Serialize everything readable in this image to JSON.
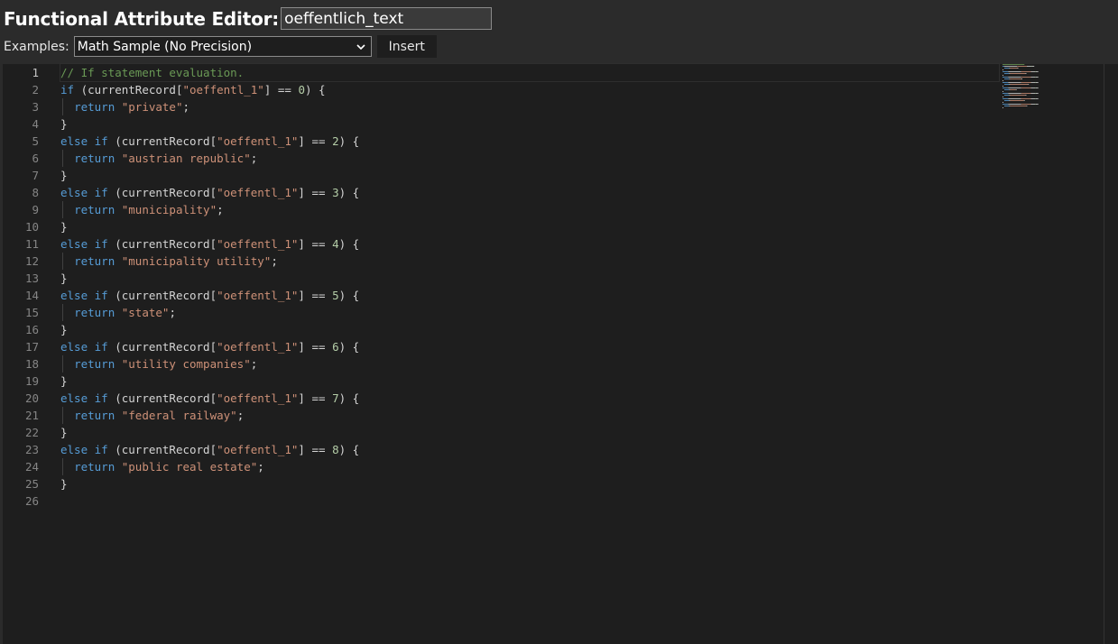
{
  "header": {
    "title_label": "Functional Attribute Editor:",
    "name_value": "oeffentlich_text",
    "examples_label": "Examples:",
    "examples_selected": "Math Sample (No Precision)",
    "insert_label": "Insert"
  },
  "editor": {
    "active_line": 1,
    "lines": [
      {
        "n": "1",
        "indent": false,
        "tokens": [
          {
            "t": "comment",
            "v": "// If statement evaluation."
          }
        ]
      },
      {
        "n": "2",
        "indent": false,
        "tokens": [
          {
            "t": "keyword",
            "v": "if"
          },
          {
            "t": "plain",
            "v": " (currentRecord["
          },
          {
            "t": "string",
            "v": "\"oeffentl_1\""
          },
          {
            "t": "plain",
            "v": "] == "
          },
          {
            "t": "number",
            "v": "0"
          },
          {
            "t": "plain",
            "v": ") {"
          }
        ]
      },
      {
        "n": "3",
        "indent": true,
        "tokens": [
          {
            "t": "keyword",
            "v": "return"
          },
          {
            "t": "plain",
            "v": " "
          },
          {
            "t": "string",
            "v": "\"private\""
          },
          {
            "t": "plain",
            "v": ";"
          }
        ]
      },
      {
        "n": "4",
        "indent": false,
        "tokens": [
          {
            "t": "plain",
            "v": "}"
          }
        ]
      },
      {
        "n": "5",
        "indent": false,
        "tokens": [
          {
            "t": "keyword",
            "v": "else if"
          },
          {
            "t": "plain",
            "v": " (currentRecord["
          },
          {
            "t": "string",
            "v": "\"oeffentl_1\""
          },
          {
            "t": "plain",
            "v": "] == "
          },
          {
            "t": "number",
            "v": "2"
          },
          {
            "t": "plain",
            "v": ") {"
          }
        ]
      },
      {
        "n": "6",
        "indent": true,
        "tokens": [
          {
            "t": "keyword",
            "v": "return"
          },
          {
            "t": "plain",
            "v": " "
          },
          {
            "t": "string",
            "v": "\"austrian republic\""
          },
          {
            "t": "plain",
            "v": ";"
          }
        ]
      },
      {
        "n": "7",
        "indent": false,
        "tokens": [
          {
            "t": "plain",
            "v": "}"
          }
        ]
      },
      {
        "n": "8",
        "indent": false,
        "tokens": [
          {
            "t": "keyword",
            "v": "else if"
          },
          {
            "t": "plain",
            "v": " (currentRecord["
          },
          {
            "t": "string",
            "v": "\"oeffentl_1\""
          },
          {
            "t": "plain",
            "v": "] == "
          },
          {
            "t": "number",
            "v": "3"
          },
          {
            "t": "plain",
            "v": ") {"
          }
        ]
      },
      {
        "n": "9",
        "indent": true,
        "tokens": [
          {
            "t": "keyword",
            "v": "return"
          },
          {
            "t": "plain",
            "v": " "
          },
          {
            "t": "string",
            "v": "\"municipality\""
          },
          {
            "t": "plain",
            "v": ";"
          }
        ]
      },
      {
        "n": "10",
        "indent": false,
        "tokens": [
          {
            "t": "plain",
            "v": "}"
          }
        ]
      },
      {
        "n": "11",
        "indent": false,
        "tokens": [
          {
            "t": "keyword",
            "v": "else if"
          },
          {
            "t": "plain",
            "v": " (currentRecord["
          },
          {
            "t": "string",
            "v": "\"oeffentl_1\""
          },
          {
            "t": "plain",
            "v": "] == "
          },
          {
            "t": "number",
            "v": "4"
          },
          {
            "t": "plain",
            "v": ") {"
          }
        ]
      },
      {
        "n": "12",
        "indent": true,
        "tokens": [
          {
            "t": "keyword",
            "v": "return"
          },
          {
            "t": "plain",
            "v": " "
          },
          {
            "t": "string",
            "v": "\"municipality utility\""
          },
          {
            "t": "plain",
            "v": ";"
          }
        ]
      },
      {
        "n": "13",
        "indent": false,
        "tokens": [
          {
            "t": "plain",
            "v": "}"
          }
        ]
      },
      {
        "n": "14",
        "indent": false,
        "tokens": [
          {
            "t": "keyword",
            "v": "else if"
          },
          {
            "t": "plain",
            "v": " (currentRecord["
          },
          {
            "t": "string",
            "v": "\"oeffentl_1\""
          },
          {
            "t": "plain",
            "v": "] == "
          },
          {
            "t": "number",
            "v": "5"
          },
          {
            "t": "plain",
            "v": ") {"
          }
        ]
      },
      {
        "n": "15",
        "indent": true,
        "tokens": [
          {
            "t": "keyword",
            "v": "return"
          },
          {
            "t": "plain",
            "v": " "
          },
          {
            "t": "string",
            "v": "\"state\""
          },
          {
            "t": "plain",
            "v": ";"
          }
        ]
      },
      {
        "n": "16",
        "indent": false,
        "tokens": [
          {
            "t": "plain",
            "v": "}"
          }
        ]
      },
      {
        "n": "17",
        "indent": false,
        "tokens": [
          {
            "t": "keyword",
            "v": "else if"
          },
          {
            "t": "plain",
            "v": " (currentRecord["
          },
          {
            "t": "string",
            "v": "\"oeffentl_1\""
          },
          {
            "t": "plain",
            "v": "] == "
          },
          {
            "t": "number",
            "v": "6"
          },
          {
            "t": "plain",
            "v": ") {"
          }
        ]
      },
      {
        "n": "18",
        "indent": true,
        "tokens": [
          {
            "t": "keyword",
            "v": "return"
          },
          {
            "t": "plain",
            "v": " "
          },
          {
            "t": "string",
            "v": "\"utility companies\""
          },
          {
            "t": "plain",
            "v": ";"
          }
        ]
      },
      {
        "n": "19",
        "indent": false,
        "tokens": [
          {
            "t": "plain",
            "v": "}"
          }
        ]
      },
      {
        "n": "20",
        "indent": false,
        "tokens": [
          {
            "t": "keyword",
            "v": "else if"
          },
          {
            "t": "plain",
            "v": " (currentRecord["
          },
          {
            "t": "string",
            "v": "\"oeffentl_1\""
          },
          {
            "t": "plain",
            "v": "] == "
          },
          {
            "t": "number",
            "v": "7"
          },
          {
            "t": "plain",
            "v": ") {"
          }
        ]
      },
      {
        "n": "21",
        "indent": true,
        "tokens": [
          {
            "t": "keyword",
            "v": "return"
          },
          {
            "t": "plain",
            "v": " "
          },
          {
            "t": "string",
            "v": "\"federal railway\""
          },
          {
            "t": "plain",
            "v": ";"
          }
        ]
      },
      {
        "n": "22",
        "indent": false,
        "tokens": [
          {
            "t": "plain",
            "v": "}"
          }
        ]
      },
      {
        "n": "23",
        "indent": false,
        "tokens": [
          {
            "t": "keyword",
            "v": "else if"
          },
          {
            "t": "plain",
            "v": " (currentRecord["
          },
          {
            "t": "string",
            "v": "\"oeffentl_1\""
          },
          {
            "t": "plain",
            "v": "] == "
          },
          {
            "t": "number",
            "v": "8"
          },
          {
            "t": "plain",
            "v": ") {"
          }
        ]
      },
      {
        "n": "24",
        "indent": true,
        "tokens": [
          {
            "t": "keyword",
            "v": "return"
          },
          {
            "t": "plain",
            "v": " "
          },
          {
            "t": "string",
            "v": "\"public real estate\""
          },
          {
            "t": "plain",
            "v": ";"
          }
        ]
      },
      {
        "n": "25",
        "indent": false,
        "tokens": [
          {
            "t": "plain",
            "v": "}"
          }
        ]
      },
      {
        "n": "26",
        "indent": false,
        "tokens": []
      }
    ]
  },
  "colors": {
    "comment": "#6a9955",
    "keyword": "#569cd6",
    "string": "#ce9178",
    "number": "#b5cea8",
    "plain": "#d4d4d4",
    "background": "#1e1e1e",
    "header": "#2b2b2b"
  },
  "icons": {
    "select_chevron": "chevron-down-icon"
  }
}
